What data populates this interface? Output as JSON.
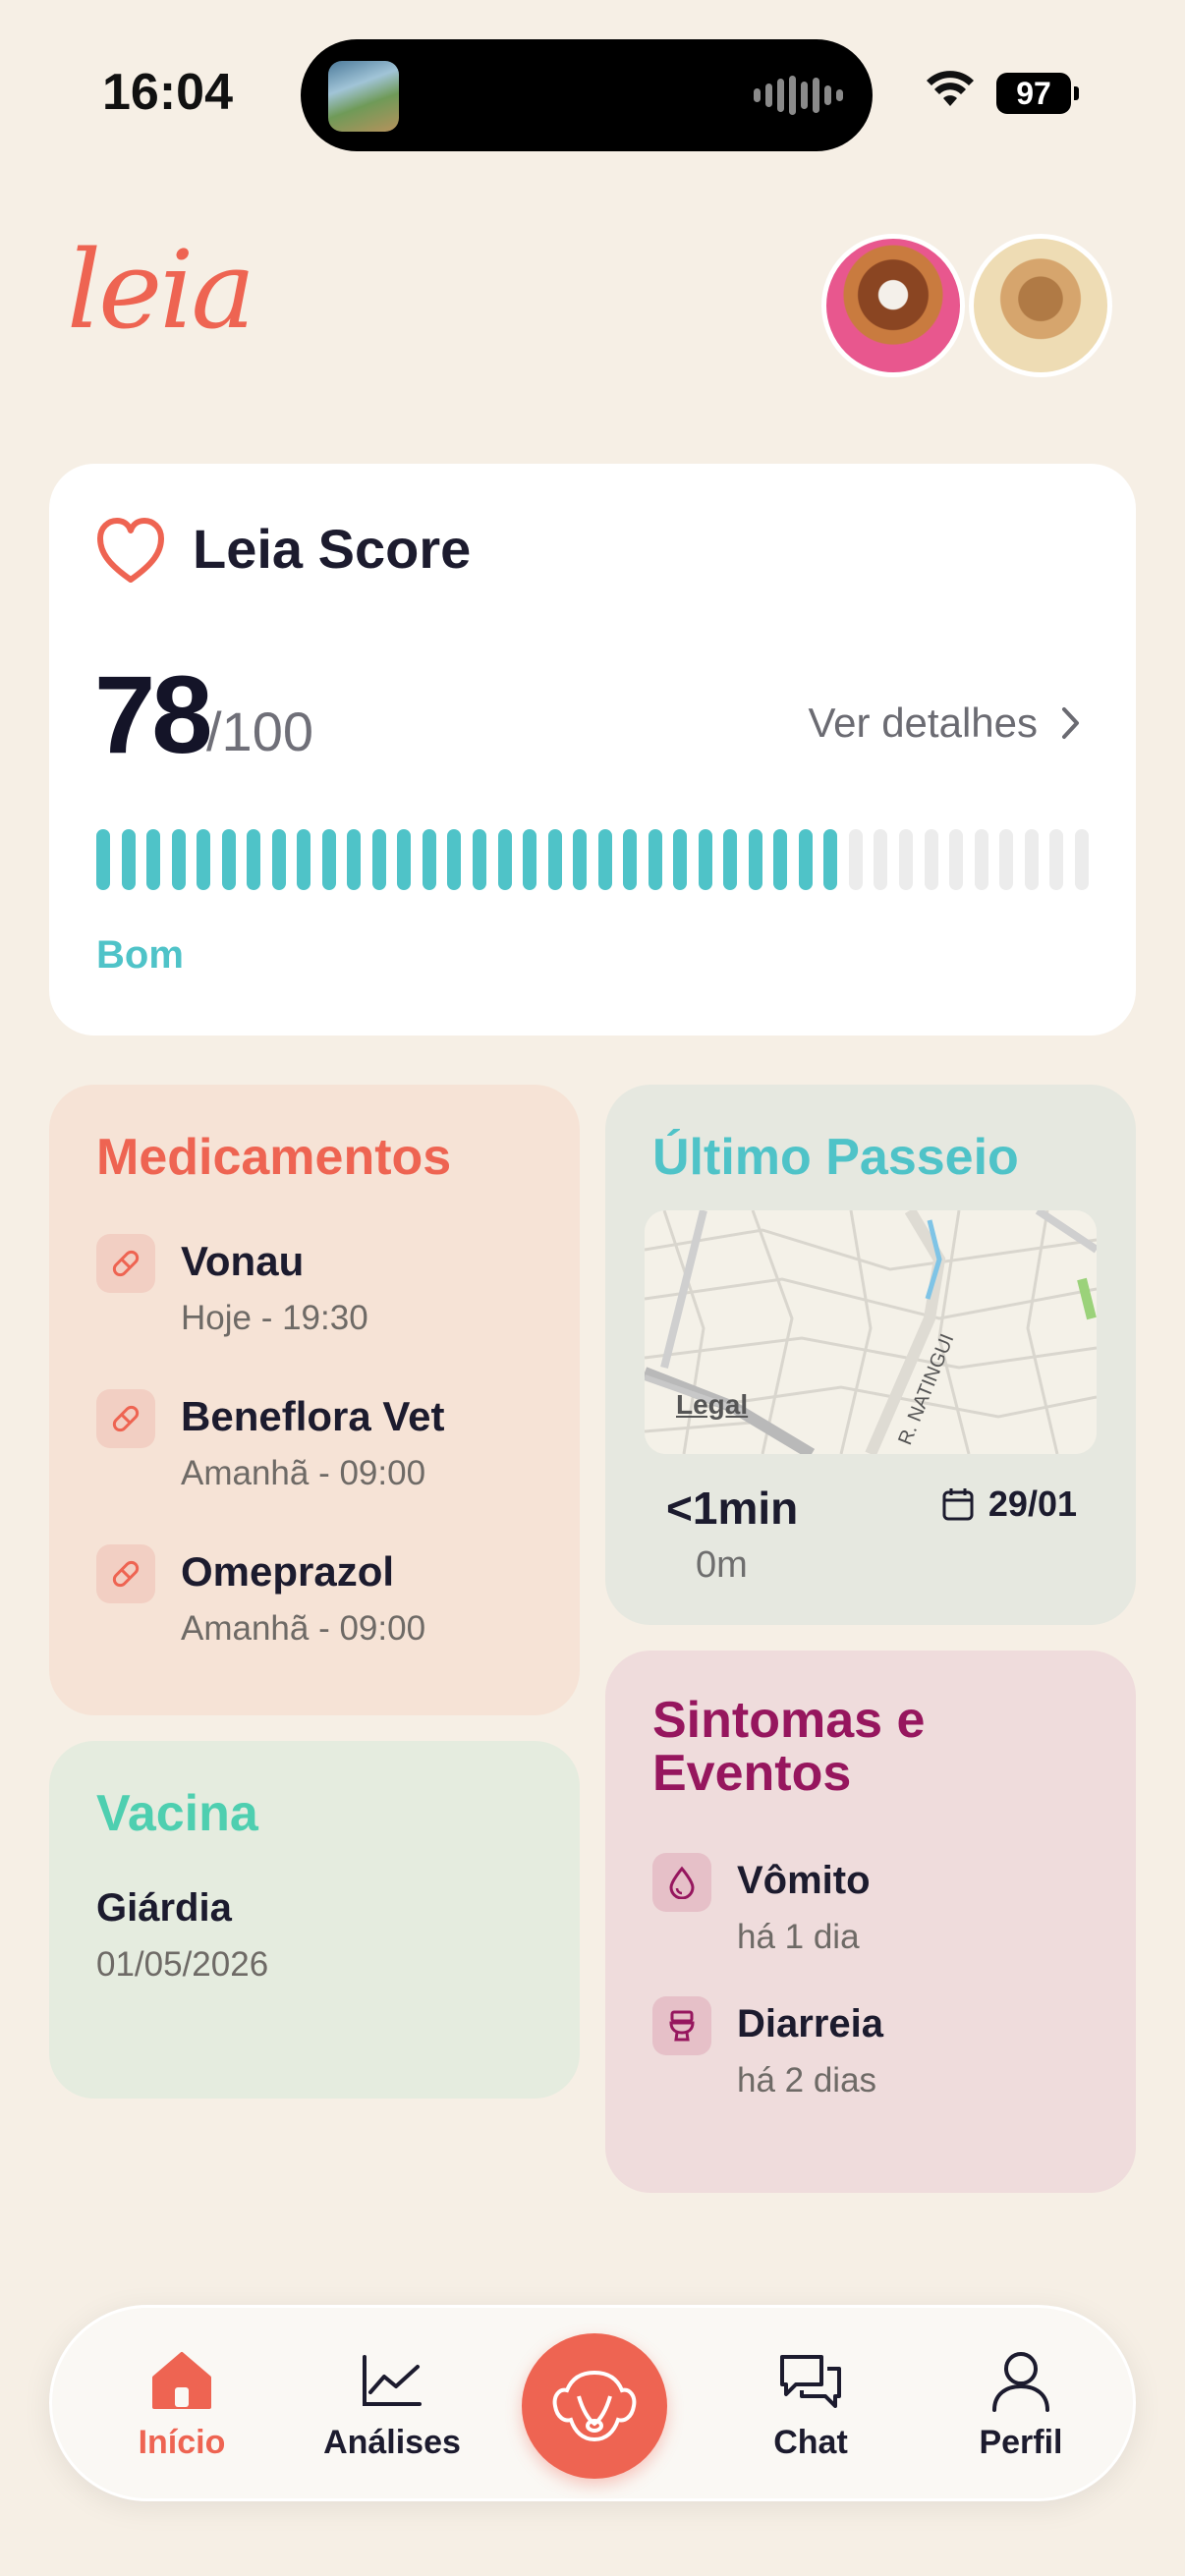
{
  "status_bar": {
    "time": "16:04",
    "battery": "97"
  },
  "header": {
    "logo": "leia"
  },
  "score": {
    "title": "Leia Score",
    "value": "78",
    "max": "/100",
    "details_link": "Ver detalhes",
    "status": "Bom",
    "level": 0.78,
    "colors": {
      "active": "#4fc3c8",
      "inactive": "#ececec"
    }
  },
  "medications": {
    "title": "Medicamentos",
    "items": [
      {
        "name": "Vonau",
        "time": "Hoje - 19:30"
      },
      {
        "name": "Beneflora Vet",
        "time": "Amanhã - 09:00"
      },
      {
        "name": "Omeprazol",
        "time": "Amanhã - 09:00"
      }
    ]
  },
  "walk": {
    "title": "Último Passeio",
    "map_legal": "Legal",
    "map_street": "R. NATINGUI",
    "duration": "<1min",
    "distance": "0m",
    "date": "29/01"
  },
  "vaccine": {
    "title": "Vacina",
    "name": "Giárdia",
    "date": "01/05/2026"
  },
  "symptoms": {
    "title": "Sintomas e Eventos",
    "items": [
      {
        "name": "Vômito",
        "when": "há 1 dia"
      },
      {
        "name": "Diarreia",
        "when": "há 2 dias"
      }
    ]
  },
  "tabbar": {
    "tabs": [
      {
        "label": "Início"
      },
      {
        "label": "Análises"
      },
      {
        "label": "Chat"
      },
      {
        "label": "Perfil"
      }
    ],
    "accent": "#ee6452"
  }
}
